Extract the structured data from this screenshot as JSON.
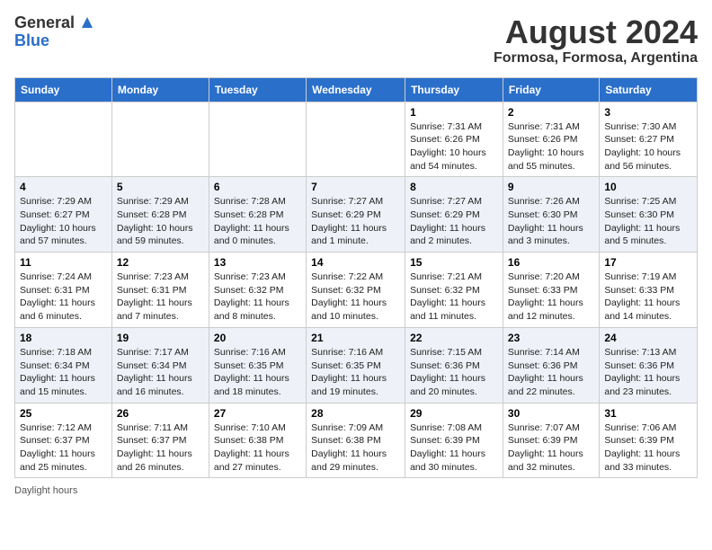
{
  "header": {
    "logo_general": "General",
    "logo_blue": "Blue",
    "title": "August 2024",
    "location": "Formosa, Formosa, Argentina"
  },
  "days_of_week": [
    "Sunday",
    "Monday",
    "Tuesday",
    "Wednesday",
    "Thursday",
    "Friday",
    "Saturday"
  ],
  "weeks": [
    [
      {
        "day": "",
        "info": ""
      },
      {
        "day": "",
        "info": ""
      },
      {
        "day": "",
        "info": ""
      },
      {
        "day": "",
        "info": ""
      },
      {
        "day": "1",
        "info": "Sunrise: 7:31 AM\nSunset: 6:26 PM\nDaylight: 10 hours\nand 54 minutes."
      },
      {
        "day": "2",
        "info": "Sunrise: 7:31 AM\nSunset: 6:26 PM\nDaylight: 10 hours\nand 55 minutes."
      },
      {
        "day": "3",
        "info": "Sunrise: 7:30 AM\nSunset: 6:27 PM\nDaylight: 10 hours\nand 56 minutes."
      }
    ],
    [
      {
        "day": "4",
        "info": "Sunrise: 7:29 AM\nSunset: 6:27 PM\nDaylight: 10 hours\nand 57 minutes."
      },
      {
        "day": "5",
        "info": "Sunrise: 7:29 AM\nSunset: 6:28 PM\nDaylight: 10 hours\nand 59 minutes."
      },
      {
        "day": "6",
        "info": "Sunrise: 7:28 AM\nSunset: 6:28 PM\nDaylight: 11 hours\nand 0 minutes."
      },
      {
        "day": "7",
        "info": "Sunrise: 7:27 AM\nSunset: 6:29 PM\nDaylight: 11 hours\nand 1 minute."
      },
      {
        "day": "8",
        "info": "Sunrise: 7:27 AM\nSunset: 6:29 PM\nDaylight: 11 hours\nand 2 minutes."
      },
      {
        "day": "9",
        "info": "Sunrise: 7:26 AM\nSunset: 6:30 PM\nDaylight: 11 hours\nand 3 minutes."
      },
      {
        "day": "10",
        "info": "Sunrise: 7:25 AM\nSunset: 6:30 PM\nDaylight: 11 hours\nand 5 minutes."
      }
    ],
    [
      {
        "day": "11",
        "info": "Sunrise: 7:24 AM\nSunset: 6:31 PM\nDaylight: 11 hours\nand 6 minutes."
      },
      {
        "day": "12",
        "info": "Sunrise: 7:23 AM\nSunset: 6:31 PM\nDaylight: 11 hours\nand 7 minutes."
      },
      {
        "day": "13",
        "info": "Sunrise: 7:23 AM\nSunset: 6:32 PM\nDaylight: 11 hours\nand 8 minutes."
      },
      {
        "day": "14",
        "info": "Sunrise: 7:22 AM\nSunset: 6:32 PM\nDaylight: 11 hours\nand 10 minutes."
      },
      {
        "day": "15",
        "info": "Sunrise: 7:21 AM\nSunset: 6:32 PM\nDaylight: 11 hours\nand 11 minutes."
      },
      {
        "day": "16",
        "info": "Sunrise: 7:20 AM\nSunset: 6:33 PM\nDaylight: 11 hours\nand 12 minutes."
      },
      {
        "day": "17",
        "info": "Sunrise: 7:19 AM\nSunset: 6:33 PM\nDaylight: 11 hours\nand 14 minutes."
      }
    ],
    [
      {
        "day": "18",
        "info": "Sunrise: 7:18 AM\nSunset: 6:34 PM\nDaylight: 11 hours\nand 15 minutes."
      },
      {
        "day": "19",
        "info": "Sunrise: 7:17 AM\nSunset: 6:34 PM\nDaylight: 11 hours\nand 16 minutes."
      },
      {
        "day": "20",
        "info": "Sunrise: 7:16 AM\nSunset: 6:35 PM\nDaylight: 11 hours\nand 18 minutes."
      },
      {
        "day": "21",
        "info": "Sunrise: 7:16 AM\nSunset: 6:35 PM\nDaylight: 11 hours\nand 19 minutes."
      },
      {
        "day": "22",
        "info": "Sunrise: 7:15 AM\nSunset: 6:36 PM\nDaylight: 11 hours\nand 20 minutes."
      },
      {
        "day": "23",
        "info": "Sunrise: 7:14 AM\nSunset: 6:36 PM\nDaylight: 11 hours\nand 22 minutes."
      },
      {
        "day": "24",
        "info": "Sunrise: 7:13 AM\nSunset: 6:36 PM\nDaylight: 11 hours\nand 23 minutes."
      }
    ],
    [
      {
        "day": "25",
        "info": "Sunrise: 7:12 AM\nSunset: 6:37 PM\nDaylight: 11 hours\nand 25 minutes."
      },
      {
        "day": "26",
        "info": "Sunrise: 7:11 AM\nSunset: 6:37 PM\nDaylight: 11 hours\nand 26 minutes."
      },
      {
        "day": "27",
        "info": "Sunrise: 7:10 AM\nSunset: 6:38 PM\nDaylight: 11 hours\nand 27 minutes."
      },
      {
        "day": "28",
        "info": "Sunrise: 7:09 AM\nSunset: 6:38 PM\nDaylight: 11 hours\nand 29 minutes."
      },
      {
        "day": "29",
        "info": "Sunrise: 7:08 AM\nSunset: 6:39 PM\nDaylight: 11 hours\nand 30 minutes."
      },
      {
        "day": "30",
        "info": "Sunrise: 7:07 AM\nSunset: 6:39 PM\nDaylight: 11 hours\nand 32 minutes."
      },
      {
        "day": "31",
        "info": "Sunrise: 7:06 AM\nSunset: 6:39 PM\nDaylight: 11 hours\nand 33 minutes."
      }
    ]
  ],
  "footer": {
    "daylight_label": "Daylight hours"
  }
}
